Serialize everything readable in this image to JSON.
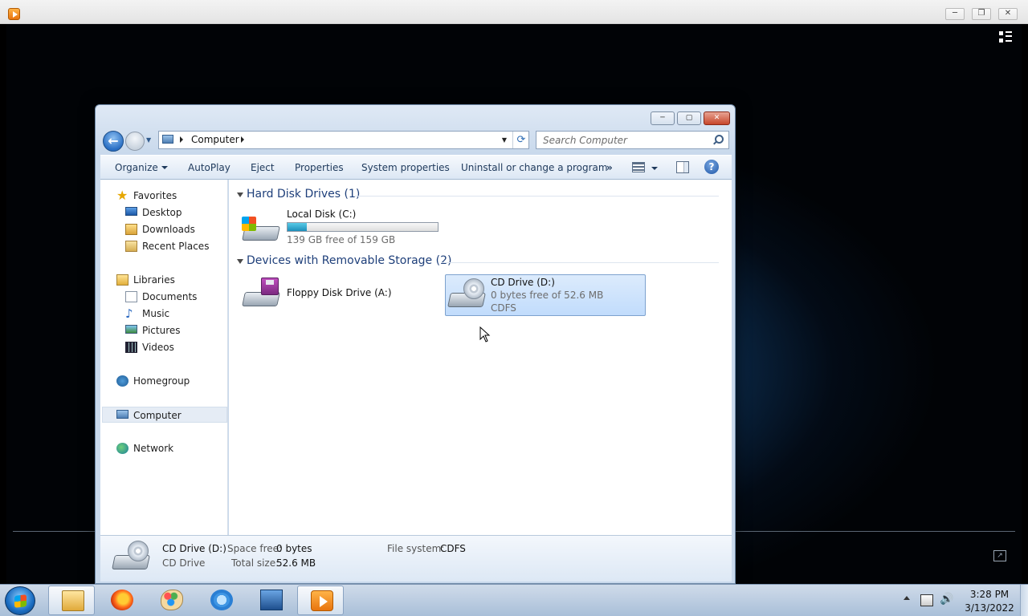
{
  "host": {
    "min_glyph": "─",
    "max_glyph": "❐",
    "close_glyph": "✕"
  },
  "explorer": {
    "window": {
      "min_glyph": "─",
      "max_glyph": "▢",
      "close_glyph": "✕"
    },
    "address": {
      "segments": [
        "Computer"
      ]
    },
    "search": {
      "placeholder": "Search Computer"
    },
    "toolbar": {
      "organize": "Organize",
      "autoplay": "AutoPlay",
      "eject": "Eject",
      "properties": "Properties",
      "system_properties": "System properties",
      "uninstall": "Uninstall or change a program",
      "more": "»",
      "help": "?"
    },
    "nav": {
      "favorites": "Favorites",
      "desktop": "Desktop",
      "downloads": "Downloads",
      "recent_places": "Recent Places",
      "libraries": "Libraries",
      "documents": "Documents",
      "music": "Music",
      "pictures": "Pictures",
      "videos": "Videos",
      "homegroup": "Homegroup",
      "computer": "Computer",
      "network": "Network"
    },
    "groups": {
      "hard_disk": "Hard Disk Drives (1)",
      "removable": "Devices with Removable Storage (2)"
    },
    "drives": {
      "c": {
        "name": "Local Disk (C:)",
        "free": "139 GB free of 159 GB",
        "used_fraction": 0.126
      },
      "a": {
        "name": "Floppy Disk Drive (A:)"
      },
      "d": {
        "name": "CD Drive (D:)",
        "free": "0 bytes free of 52.6 MB",
        "fs": "CDFS"
      }
    },
    "details": {
      "name": "CD Drive (D:)",
      "type": "CD Drive",
      "space_free_label": "Space free:",
      "space_free_value": "0 bytes",
      "total_size_label": "Total size:",
      "total_size_value": "52.6 MB",
      "fs_label": "File system:",
      "fs_value": "CDFS"
    }
  },
  "taskbar": {
    "clock_time": "3:28 PM",
    "clock_date": "3/13/2022",
    "apps": [
      "windows-explorer",
      "firefox",
      "paint",
      "internet-explorer",
      "remote-desktop",
      "media-player"
    ]
  },
  "colors": {
    "accent": "#1e3f7a",
    "selection": "#c1dcfc",
    "progress": "#1d8fba"
  }
}
